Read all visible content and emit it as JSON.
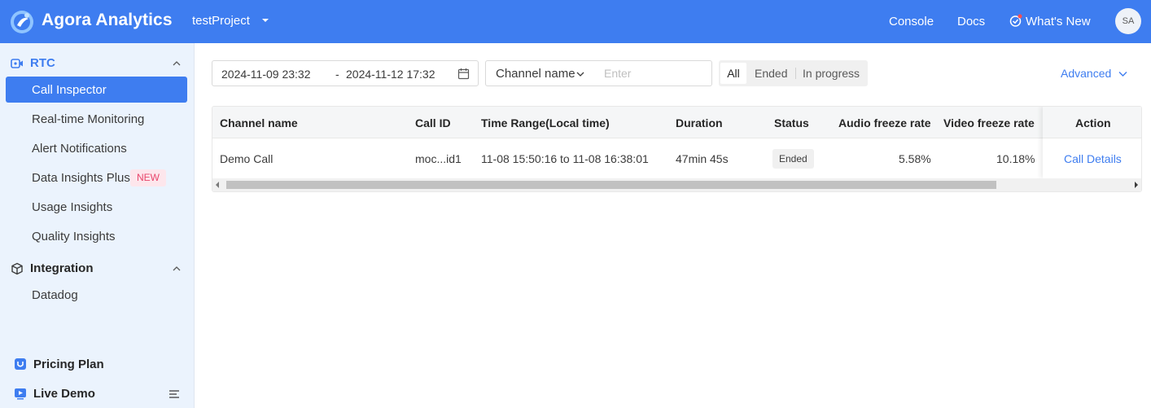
{
  "header": {
    "app_title": "Agora Analytics",
    "project": "testProject",
    "nav": {
      "console": "Console",
      "docs": "Docs",
      "whats_new": "What's New"
    },
    "avatar_initials": "SA"
  },
  "sidebar": {
    "rtc": {
      "title": "RTC",
      "items": [
        {
          "label": "Call Inspector",
          "active": true
        },
        {
          "label": "Real-time Monitoring"
        },
        {
          "label": "Alert Notifications"
        },
        {
          "label": "Data Insights Plus",
          "badge": "NEW"
        },
        {
          "label": "Usage Insights"
        },
        {
          "label": "Quality Insights"
        }
      ]
    },
    "integration": {
      "title": "Integration",
      "items": [
        {
          "label": "Datadog"
        }
      ]
    },
    "footer": {
      "pricing_plan": "Pricing Plan",
      "live_demo": "Live Demo"
    }
  },
  "filters": {
    "date_start": "2024-11-09 23:32",
    "date_separator": "-",
    "date_end": "2024-11-12 17:32",
    "field_select": "Channel name",
    "search_placeholder": "Enter",
    "status_tabs": {
      "all": "All",
      "ended": "Ended",
      "in_progress": "In progress",
      "selected": "All"
    },
    "advanced": "Advanced"
  },
  "table": {
    "columns": {
      "channel_name": "Channel name",
      "call_id": "Call ID",
      "time_range": "Time Range(Local time)",
      "duration": "Duration",
      "status": "Status",
      "audio_freeze": "Audio freeze rate",
      "video_freeze": "Video freeze rate",
      "action": "Action"
    },
    "rows": [
      {
        "channel_name": "Demo Call",
        "call_id": "moc...id1",
        "time_range": "11-08 15:50:16 to 11-08 16:38:01",
        "duration": "47min 45s",
        "status": "Ended",
        "audio_freeze": "5.58%",
        "video_freeze": "10.18%",
        "action": "Call Details"
      }
    ]
  },
  "colors": {
    "primary": "#3e7df0",
    "sidebar_bg": "#ebf3fd",
    "new_badge": "#e8456b"
  }
}
